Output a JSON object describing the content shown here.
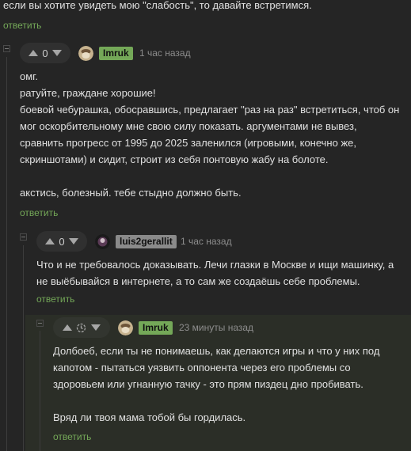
{
  "colors": {
    "background": "#252525",
    "highlight": "#2b2e27",
    "reply": "#74a858",
    "badge_green": "#74a858",
    "badge_gray": "#8a8a8a"
  },
  "reply_label": "ответить",
  "top": {
    "text": "если вы хотите увидеть мою \"слабость\", то давайте встретимся."
  },
  "comments": [
    {
      "score": "0",
      "username": "Imruk",
      "time": "1 час назад",
      "lines": [
        "омг.",
        "ратуйте, граждане хорошие!",
        "боевой чебурашка, обосравшись, предлагает \"раз на раз\" встретиться, чтоб он",
        "мог оскорбительному мне свою силу показать. аргументами не вывез,",
        "сравнить прогресс от 1995 до 2025 заленился (игровыми, конечно же,",
        "скриншотами) и сидит, строит из себя понтовую жабу на болоте.",
        "",
        "акстись, болезный. тебе стыдно должно быть."
      ]
    },
    {
      "score": "0",
      "username": "luis2gerallit",
      "time": "1 час назад",
      "lines": [
        "Что и не требовалось доказывать. Лечи глазки в Москве и ищи машинку, а",
        "не выёбывайся в интернете, а то сам же создаёшь себе проблемы."
      ]
    },
    {
      "username": "Imruk",
      "time": "23 минуты назад",
      "lines": [
        "Долбоеб, если ты не понимаешь, как делаются игры и что у них под",
        "капотом - пытаться уязвить оппонента через его проблемы со",
        "здоровьем или угнанную тачку - это прям пиздец дно пробивать.",
        "",
        "Вряд ли твоя мама тобой бы гордилась."
      ]
    }
  ]
}
